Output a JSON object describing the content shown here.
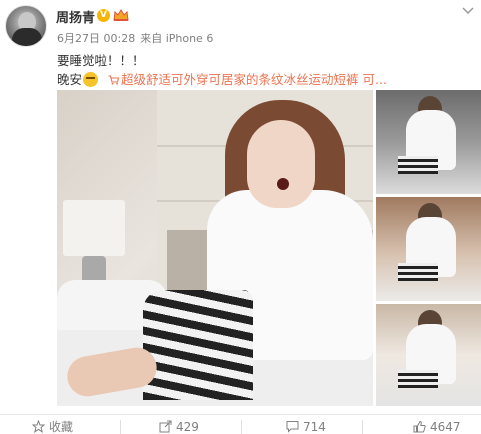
{
  "post": {
    "username": "周扬青",
    "verified_badge": "V",
    "meta": {
      "time": "6月27日 00:28",
      "source": "来自 iPhone 6"
    },
    "text_line1": "要睡觉啦！！！",
    "text_line2": "晚安",
    "product_link": "超级舒适可外穿可居家的条纹冰丝运动短裤 可..."
  },
  "actions": {
    "favorite": "收藏",
    "share_count": "429",
    "comment_count": "714",
    "like_count": "4647"
  },
  "icons": [
    "avatar",
    "verified-icon",
    "crown-icon",
    "chevron-down-icon",
    "sleepy-emoji-icon",
    "cart-icon",
    "star-icon",
    "share-icon",
    "comment-icon",
    "like-icon"
  ],
  "colors": {
    "link": "#eb7350",
    "meta_text": "#808080",
    "badge": "#f7b500"
  }
}
